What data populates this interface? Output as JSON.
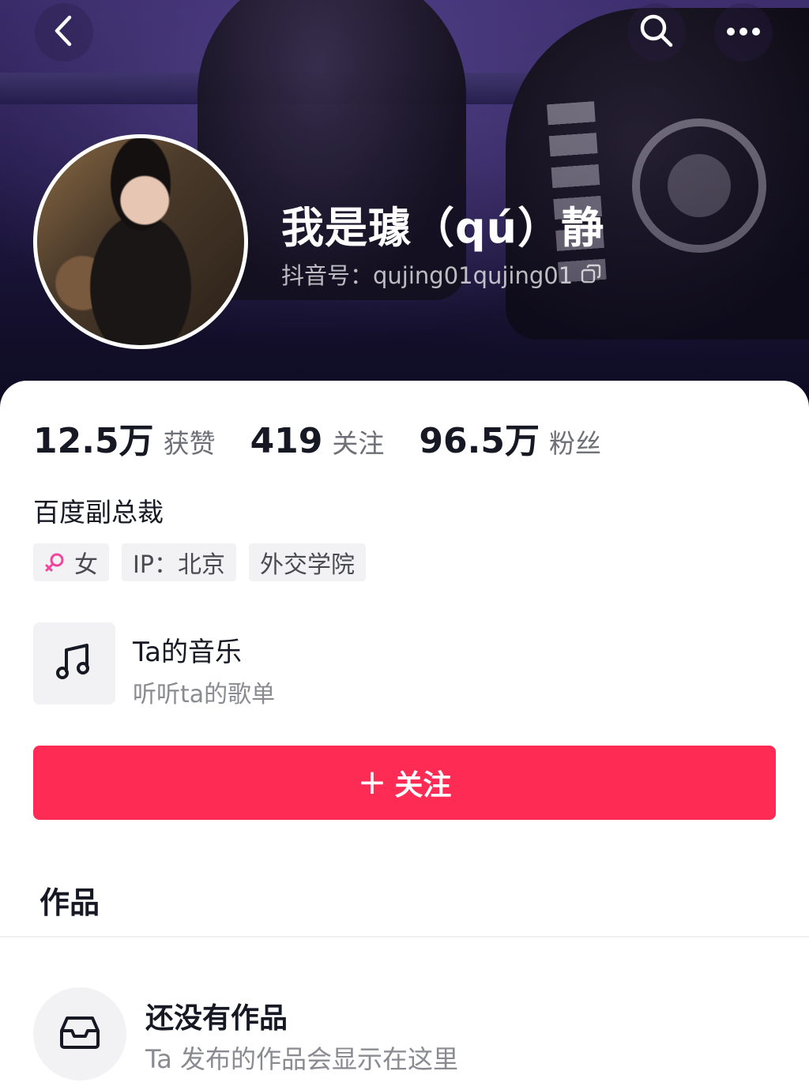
{
  "colors": {
    "accent": "#fe2c55",
    "female_icon": "#f0459c",
    "text_primary": "#161823",
    "text_secondary": "#8a8b91"
  },
  "header": {
    "back_icon": "chevron-left-icon",
    "search_icon": "search-icon",
    "more_icon": "more-horizontal-icon"
  },
  "profile": {
    "nickname": "我是璩（qú）静",
    "douyin_id": "抖音号：qujing01qujing01",
    "copy_icon": "copy-icon"
  },
  "stats": [
    {
      "value": "12.5万",
      "label": "获赞"
    },
    {
      "value": "419",
      "label": "关注"
    },
    {
      "value": "96.5万",
      "label": "粉丝"
    }
  ],
  "bio": "百度副总裁",
  "tags": {
    "gender": "女",
    "ip": "IP：北京",
    "school": "外交学院"
  },
  "music": {
    "icon": "music-note-icon",
    "title": "Ta的音乐",
    "subtitle": "听听ta的歌单"
  },
  "follow_button": {
    "plus": "+",
    "label": "关注"
  },
  "works": {
    "title": "作品",
    "empty_icon": "inbox-tray-icon",
    "empty_title": "还没有作品",
    "empty_subtitle": "Ta 发布的作品会显示在这里"
  }
}
